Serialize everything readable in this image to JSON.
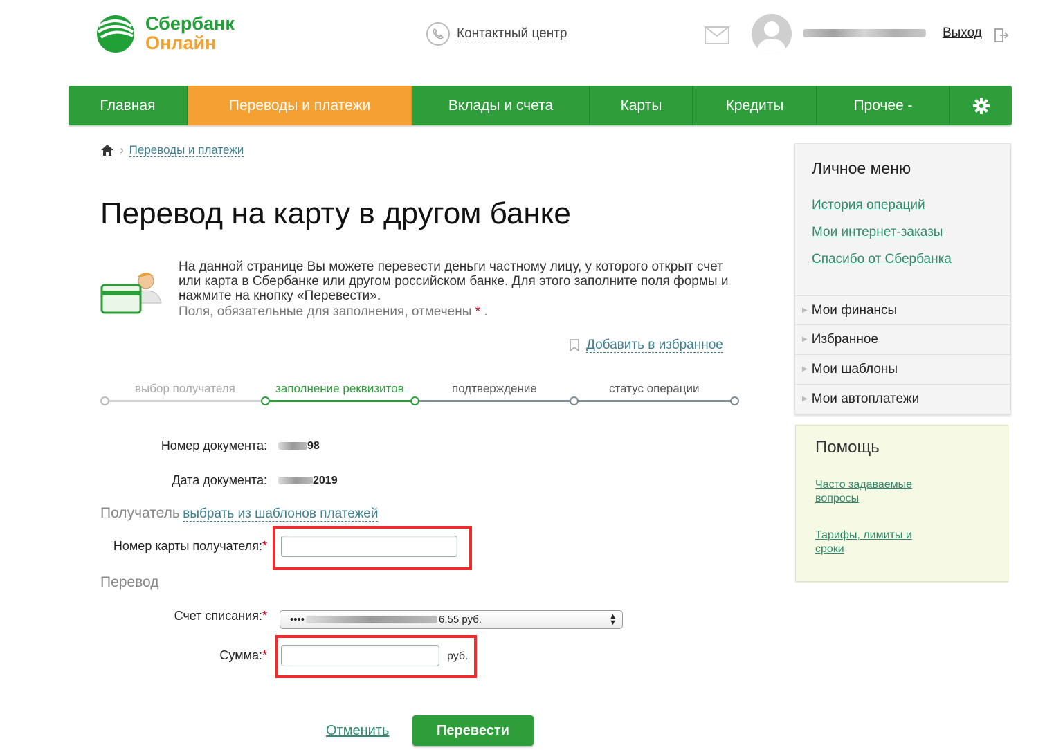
{
  "header": {
    "logo_line1": "Сбербанк",
    "logo_line2": "Онлайн",
    "contact_center": "Контактный центр",
    "logout": "Выход"
  },
  "nav": {
    "items": [
      "Главная",
      "Переводы и платежи",
      "Вклады и счета",
      "Карты",
      "Кредиты",
      "Прочее -"
    ],
    "active_index": 1
  },
  "breadcrumb": {
    "section": "Переводы и платежи"
  },
  "page": {
    "title": "Перевод на карту в другом банке",
    "description": "На данной странице Вы можете перевести деньги частному лицу, у которого открыт счет или карта в Сбербанке или другом российском банке. Для этого заполните поля формы и нажмите на кнопку «Перевести».",
    "required_note": "Поля, обязательные для заполнения, отмечены",
    "required_star": "*",
    "required_dot": ".",
    "add_favorite": "Добавить в избранное"
  },
  "steps": [
    {
      "label": "выбор получателя",
      "state": "done"
    },
    {
      "label": "заполнение реквизитов",
      "state": "active"
    },
    {
      "label": "подтверждение",
      "state": "pending"
    },
    {
      "label": "статус операции",
      "state": "pending"
    }
  ],
  "form": {
    "doc_number_label": "Номер документа:",
    "doc_number_value": "98",
    "doc_date_label": "Дата документа:",
    "doc_date_value": "2019",
    "recipient_heading": "Получатель",
    "recipient_template_link": "выбрать из шаблонов платежей",
    "card_number_label": "Номер карты получателя:",
    "card_number_value": "",
    "transfer_heading": "Перевод",
    "account_label": "Счет списания:",
    "account_value_prefix": "••••",
    "account_value_suffix": "6,55  руб.",
    "amount_label": "Сумма:",
    "amount_value": "",
    "amount_unit": "руб.",
    "required_star": "*"
  },
  "actions": {
    "cancel": "Отменить",
    "submit": "Перевести"
  },
  "sidebar": {
    "personal_menu_title": "Личное меню",
    "links": [
      "История операций",
      "Мои интернет-заказы",
      "Спасибо от Сбербанка"
    ],
    "rows": [
      "Мои финансы",
      "Избранное",
      "Мои шаблоны",
      "Мои автоплатежи"
    ],
    "help_title": "Помощь",
    "help_links": [
      "Часто задаваемые вопросы",
      "Тарифы, лимиты и сроки"
    ]
  },
  "colors": {
    "brand_green": "#2e9e3b",
    "accent_orange": "#f5a032",
    "highlight_red": "#ef2b2b",
    "step_active": "#2e9e3b"
  }
}
